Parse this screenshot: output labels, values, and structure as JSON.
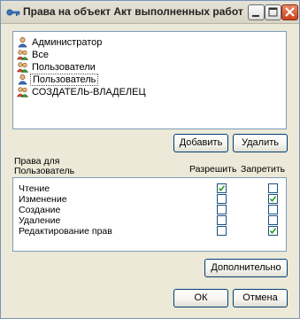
{
  "window": {
    "title": "Права на объект Акт выполненных работ"
  },
  "principals": [
    {
      "name": "Администратор",
      "icon": "user-icon",
      "selected": false
    },
    {
      "name": "Все",
      "icon": "group-icon",
      "selected": false
    },
    {
      "name": "Пользователи",
      "icon": "group-icon",
      "selected": false
    },
    {
      "name": "Пользователь",
      "icon": "user-icon",
      "selected": true
    },
    {
      "name": "СОЗДАТЕЛЬ-ВЛАДЕЛЕЦ",
      "icon": "group-icon",
      "selected": false
    }
  ],
  "buttons": {
    "add": "Добавить",
    "remove": "Удалить",
    "advanced": "Дополнительно",
    "ok": "ОК",
    "cancel": "Отмена"
  },
  "permissions_header": {
    "line1": "Права для",
    "line2": "Пользователь",
    "allow": "Разрешить",
    "deny": "Запретить"
  },
  "permissions": [
    {
      "name": "Чтение",
      "allow": true,
      "deny": false
    },
    {
      "name": "Изменение",
      "allow": false,
      "deny": true
    },
    {
      "name": "Создание",
      "allow": false,
      "deny": false
    },
    {
      "name": "Удаление",
      "allow": false,
      "deny": false
    },
    {
      "name": "Редактирование прав",
      "allow": false,
      "deny": true
    }
  ]
}
